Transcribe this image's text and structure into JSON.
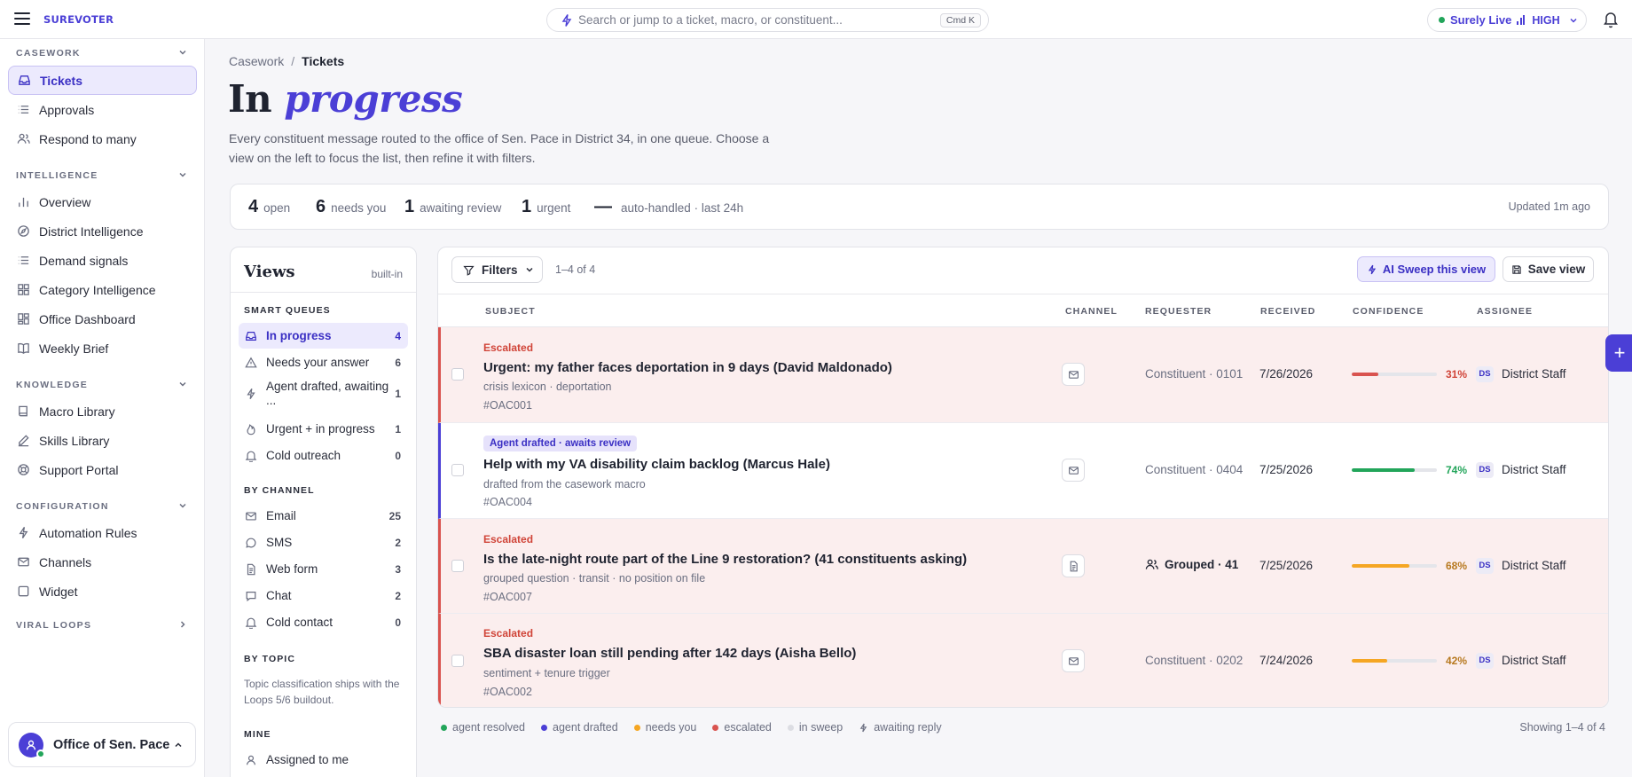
{
  "topbar": {
    "logo": "SUREVOTER",
    "search_placeholder": "Search or jump to a ticket, macro, or constituent...",
    "search_kbd": "Cmd K",
    "live_label": "Surely Live",
    "live_level": "HIGH"
  },
  "sidebar": {
    "sections": [
      {
        "header": "CASEWORK",
        "items": [
          "Tickets",
          "Approvals",
          "Respond to many"
        ]
      },
      {
        "header": "INTELLIGENCE",
        "items": [
          "Overview",
          "District Intelligence",
          "Demand signals",
          "Category Intelligence",
          "Office Dashboard",
          "Weekly Brief"
        ]
      },
      {
        "header": "KNOWLEDGE",
        "items": [
          "Macro Library",
          "Skills Library",
          "Support Portal"
        ]
      },
      {
        "header": "CONFIGURATION",
        "items": [
          "Automation Rules",
          "Channels",
          "Widget"
        ]
      },
      {
        "header": "VIRAL LOOPS",
        "items": []
      }
    ],
    "active_item": "Tickets",
    "office": "Office of Sen. Pace"
  },
  "page": {
    "breadcrumb_parent": "Casework",
    "breadcrumb_current": "Tickets",
    "title_plain": "In",
    "title_em": "progress",
    "description": "Every constituent message routed to the office of Sen. Pace in District 34, in one queue. Choose a view on the left to focus the list, then refine it with filters."
  },
  "stats": {
    "items": [
      {
        "value": "4",
        "label": "open"
      },
      {
        "value": "6",
        "label": "needs you"
      },
      {
        "value": "1",
        "label": "awaiting review"
      },
      {
        "value": "1",
        "label": "urgent"
      },
      {
        "value": "—",
        "label": "auto-handled · last 24h"
      }
    ],
    "updated": "Updated 1m ago"
  },
  "views": {
    "title": "Views",
    "badge": "built-in",
    "smart_header": "SMART QUEUES",
    "smart": [
      {
        "label": "In progress",
        "count": "4"
      },
      {
        "label": "Needs your answer",
        "count": "6"
      },
      {
        "label": "Agent drafted, awaiting ...",
        "count": "1"
      },
      {
        "label": "Urgent + in progress",
        "count": "1"
      },
      {
        "label": "Cold outreach",
        "count": "0"
      }
    ],
    "channel_header": "BY CHANNEL",
    "channels": [
      {
        "label": "Email",
        "count": "25"
      },
      {
        "label": "SMS",
        "count": "2"
      },
      {
        "label": "Web form",
        "count": "3"
      },
      {
        "label": "Chat",
        "count": "2"
      },
      {
        "label": "Cold contact",
        "count": "0"
      }
    ],
    "topic_header": "BY TOPIC",
    "topic_note": "Topic classification ships with the Loops 5/6 buildout.",
    "mine_header": "MINE",
    "mine": [
      {
        "label": "Assigned to me"
      }
    ]
  },
  "toolbar": {
    "filters_label": "Filters",
    "range": "1–4 of 4",
    "sweep_label": "AI Sweep this view",
    "save_label": "Save view"
  },
  "table": {
    "columns": [
      "SUBJECT",
      "CHANNEL",
      "REQUESTER",
      "RECEIVED",
      "CONFIDENCE",
      "ASSIGNEE"
    ],
    "rows": [
      {
        "tag": "Escalated",
        "subject": "Urgent: my father faces deportation in 9 days (David Maldonado)",
        "meta": "crisis lexicon · deportation",
        "id": "#OAC001",
        "channel": "email",
        "requester": "Constituent · 0101",
        "received": "7/26/2026",
        "confidence": 31,
        "confidence_label": "31%",
        "assignee_initials": "DS",
        "assignee": "District Staff"
      },
      {
        "tag": "Agent drafted · awaits review",
        "subject": "Help with my VA disability claim backlog (Marcus Hale)",
        "meta": "drafted from the casework macro",
        "id": "#OAC004",
        "channel": "email",
        "requester": "Constituent · 0404",
        "received": "7/25/2026",
        "confidence": 74,
        "confidence_label": "74%",
        "assignee_initials": "DS",
        "assignee": "District Staff"
      },
      {
        "tag": "Escalated",
        "subject": "Is the late-night route part of the Line 9 restoration? (41 constituents asking)",
        "meta": "grouped question · transit · no position on file",
        "id": "#OAC007",
        "channel": "web-form",
        "requester": "Grouped · 41",
        "received": "7/25/2026",
        "confidence": 68,
        "confidence_label": "68%",
        "assignee_initials": "DS",
        "assignee": "District Staff"
      },
      {
        "tag": "Escalated",
        "subject": "SBA disaster loan still pending after 142 days (Aisha Bello)",
        "meta": "sentiment + tenure trigger",
        "id": "#OAC002",
        "channel": "email",
        "requester": "Constituent · 0202",
        "received": "7/24/2026",
        "confidence": 42,
        "confidence_label": "42%",
        "assignee_initials": "DS",
        "assignee": "District Staff"
      }
    ]
  },
  "legend": {
    "items": [
      {
        "label": "agent resolved",
        "color": "#22a55a"
      },
      {
        "label": "agent drafted",
        "color": "#4b3fd6"
      },
      {
        "label": "needs you",
        "color": "#f5a623"
      },
      {
        "label": "escalated",
        "color": "#d9534f"
      },
      {
        "label": "in sweep",
        "color": "#dcdde3"
      },
      {
        "label": "awaiting reply",
        "color": "#6a6e80"
      }
    ],
    "showing": "Showing 1–4 of 4"
  },
  "colors": {
    "accent": "#4b3fd6",
    "danger": "#d9534f",
    "success": "#22a55a",
    "warning": "#f5a623"
  }
}
